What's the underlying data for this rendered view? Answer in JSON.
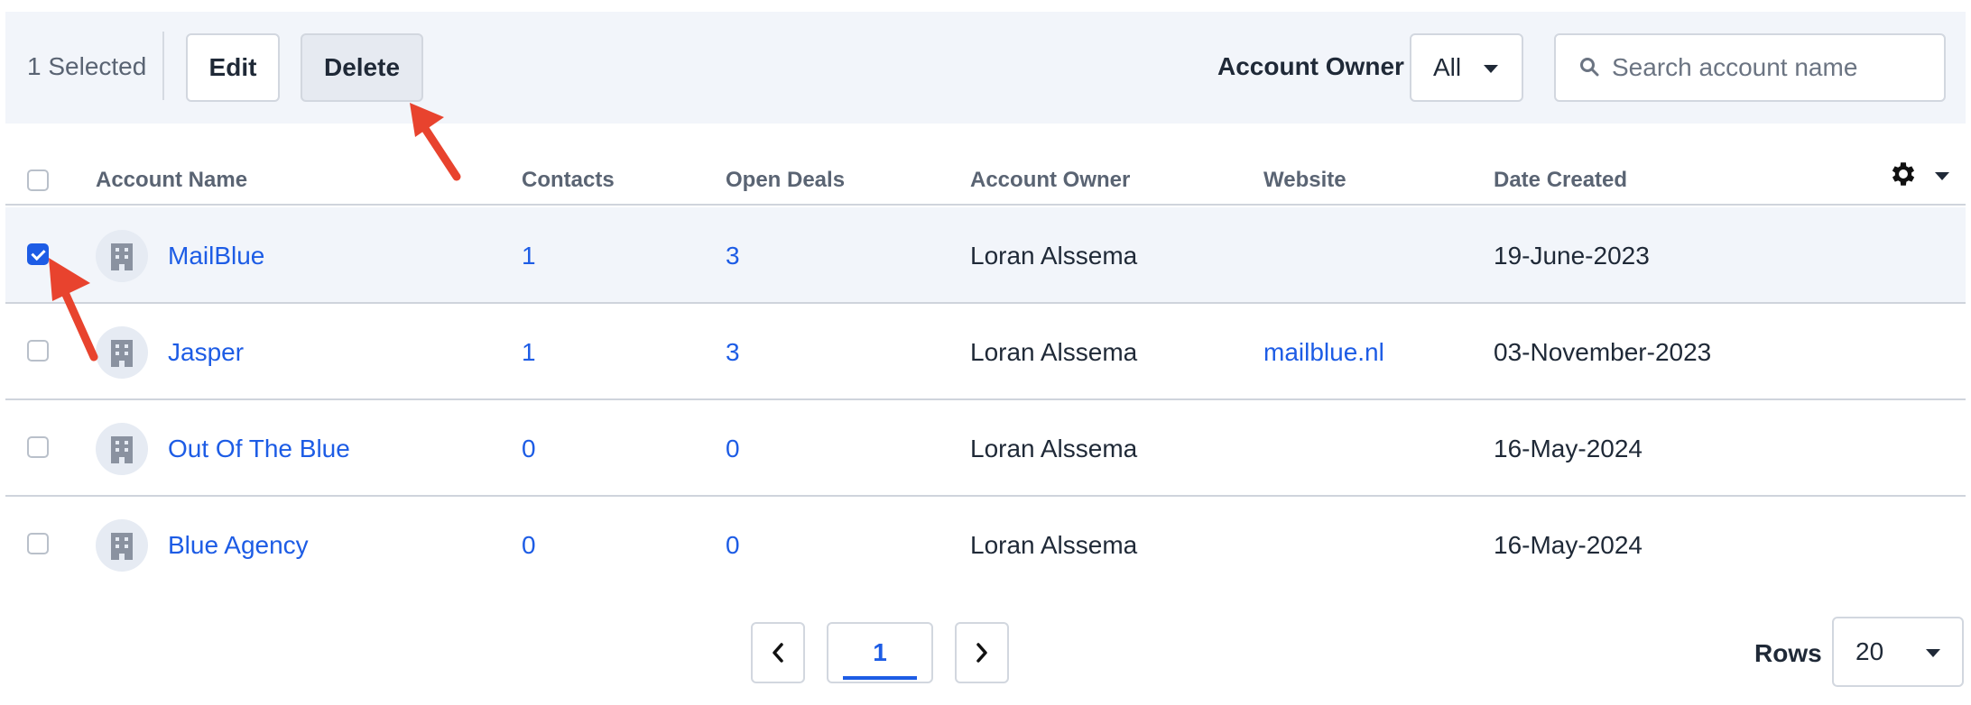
{
  "toolbar": {
    "selected_text": "1 Selected",
    "edit_label": "Edit",
    "delete_label": "Delete",
    "owner_filter_label": "Account Owner",
    "owner_filter_value": "All",
    "search_placeholder": "Search account name"
  },
  "table": {
    "columns": [
      "Account Name",
      "Contacts",
      "Open Deals",
      "Account Owner",
      "Website",
      "Date Created"
    ],
    "rows": [
      {
        "name": "MailBlue",
        "contacts": "1",
        "open_deals": "3",
        "owner": "Loran Alssema",
        "website": "",
        "date_created": "19-June-2023",
        "checked": true
      },
      {
        "name": "Jasper",
        "contacts": "1",
        "open_deals": "3",
        "owner": "Loran Alssema",
        "website": "mailblue.nl",
        "date_created": "03-November-2023",
        "checked": false
      },
      {
        "name": "Out Of The Blue",
        "contacts": "0",
        "open_deals": "0",
        "owner": "Loran Alssema",
        "website": "",
        "date_created": "16-May-2024",
        "checked": false
      },
      {
        "name": "Blue Agency",
        "contacts": "0",
        "open_deals": "0",
        "owner": "Loran Alssema",
        "website": "",
        "date_created": "16-May-2024",
        "checked": false
      }
    ]
  },
  "pagination": {
    "current_page": "1",
    "rows_label": "Rows",
    "rows_value": "20"
  },
  "colors": {
    "accent": "#1d5ce5",
    "annotation_arrow": "#e8432e",
    "toolbar_bg": "#f2f5fa"
  },
  "icons": [
    "search-icon",
    "building-icon",
    "gear-icon",
    "chevron-left-icon",
    "chevron-right-icon",
    "chevron-down-icon"
  ]
}
